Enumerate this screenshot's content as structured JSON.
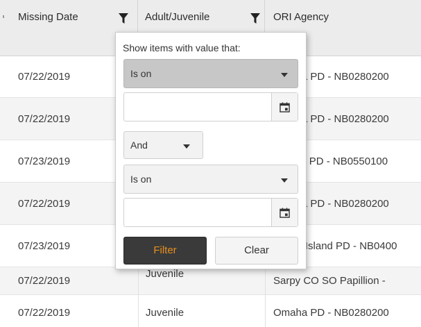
{
  "columns": [
    {
      "label": "Missing Date"
    },
    {
      "label": "Adult/Juvenile"
    },
    {
      "label": "ORI Agency"
    }
  ],
  "rows": [
    {
      "date": "07/22/2019",
      "age": "",
      "agency": "Omaha PD - NB0280200"
    },
    {
      "date": "07/22/2019",
      "age": "",
      "agency": "Omaha PD - NB0280200"
    },
    {
      "date": "07/23/2019",
      "age": "",
      "agency": "Lincoln PD - NB0550100"
    },
    {
      "date": "07/22/2019",
      "age": "",
      "agency": "Omaha PD - NB0280200"
    },
    {
      "date": "07/23/2019",
      "age": "",
      "agency": "Grand Island PD - NB0400"
    },
    {
      "date": "07/22/2019",
      "age": "Juvenile",
      "agency": "Sarpy CO SO Papillion -"
    },
    {
      "date": "07/22/2019",
      "age": "Juvenile",
      "agency": "Omaha PD - NB0280200"
    }
  ],
  "filter_popup": {
    "title": "Show items with value that:",
    "operator1": "Is on",
    "value1": "",
    "logic": "And",
    "operator2": "Is on",
    "value2": "",
    "filter_label": "Filter",
    "clear_label": "Clear"
  },
  "colors": {
    "header_bg": "#ececec",
    "row_alt_bg": "#f4f4f4",
    "filter_button_bg": "#3a3a3a",
    "filter_button_text": "#e8901e"
  },
  "icons": [
    "funnel-icon",
    "calendar-icon",
    "dropdown-arrow-icon"
  ]
}
